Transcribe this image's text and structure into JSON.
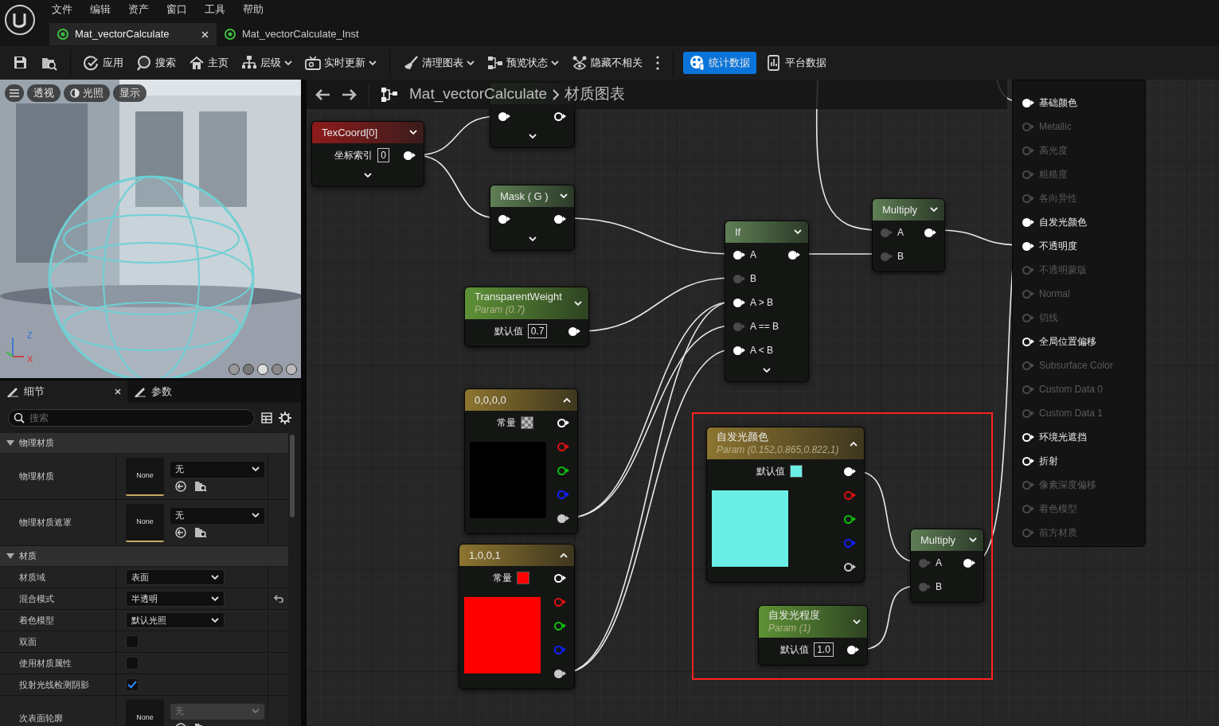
{
  "menu": [
    "文件",
    "编辑",
    "资产",
    "窗口",
    "工具",
    "帮助"
  ],
  "tabs": [
    {
      "label": "Mat_vectorCalculate",
      "selected": true,
      "closable": true
    },
    {
      "label": "Mat_vectorCalculate_Inst",
      "selected": false,
      "closable": false
    }
  ],
  "toolbar": [
    [
      {
        "selected": false,
        "dropdown": false
      },
      {
        "selected": false,
        "dropdown": false
      }
    ],
    [
      {
        "label": "应用",
        "selected": false,
        "dropdown": false
      },
      {
        "label": "搜索",
        "selected": false,
        "dropdown": false
      },
      {
        "label": "主页",
        "selected": false,
        "dropdown": false
      },
      {
        "label": "层级",
        "selected": false,
        "dropdown": true
      },
      {
        "label": "实时更新",
        "selected": false,
        "dropdown": true
      }
    ],
    [
      {
        "label": "清理图表",
        "selected": false,
        "dropdown": true
      },
      {
        "label": "预览状态",
        "selected": false,
        "dropdown": true
      },
      {
        "label": "隐藏不相关",
        "selected": false,
        "dropdown": false
      },
      {
        "selected": false,
        "dropdown": false
      }
    ],
    [
      {
        "label": "统计数据",
        "selected": true,
        "dropdown": false
      },
      {
        "label": "平台数据",
        "selected": false,
        "dropdown": false
      }
    ]
  ],
  "viewport": {
    "buttons": [
      {
        "label": "透视"
      },
      {
        "label": "光照"
      },
      {
        "label": "显示"
      }
    ],
    "axes": [
      "Z",
      "X"
    ]
  },
  "details": {
    "tabs": [
      {
        "label": "细节",
        "selected": true,
        "closable": true
      },
      {
        "label": "参数",
        "selected": false,
        "closable": false
      }
    ],
    "search": {
      "placeholder": "搜索"
    },
    "sections": [
      {
        "title": "物理材质",
        "expanded": true,
        "rows": [
          {
            "kind": "asset",
            "label": "物理材质",
            "thumb": "None",
            "value": "无",
            "disabled": false
          },
          {
            "kind": "asset",
            "label": "物理材质遮罩",
            "thumb": "None",
            "value": "无",
            "disabled": false
          }
        ]
      },
      {
        "title": "材质",
        "expanded": true,
        "rows": [
          {
            "kind": "dropdown",
            "label": "材质域",
            "value": "表面",
            "resettable": false
          },
          {
            "kind": "dropdown",
            "label": "混合模式",
            "value": "半透明",
            "resettable": true
          },
          {
            "kind": "dropdown",
            "label": "着色模型",
            "value": "默认光照",
            "resettable": false
          },
          {
            "kind": "checkbox",
            "label": "双面",
            "checked": false
          },
          {
            "kind": "checkbox",
            "label": "使用材质属性",
            "checked": false
          },
          {
            "kind": "checkbox",
            "label": "投射光线检测阴影",
            "checked": true
          },
          {
            "kind": "asset",
            "label": "次表面轮廓",
            "thumb": "None",
            "value": "无",
            "disabled": true
          }
        ]
      }
    ]
  },
  "graph": {
    "breadcrumb": [
      "Mat_vectorCalculate",
      "材质图表"
    ],
    "nodes": [
      {
        "kind": "function",
        "more_pins": true,
        "rows": [
          {
            "in_connected": true,
            "out_connected": false
          }
        ]
      },
      {
        "kind": "coordinate",
        "title": "TexCoord[0]",
        "expanded": false,
        "more_pins": true,
        "rows": [
          {
            "label": "坐标索引",
            "value": "0",
            "out_connected": true
          }
        ]
      },
      {
        "kind": "function",
        "title": "Mask ( G )",
        "expanded": false,
        "more_pins": true,
        "rows": [
          {
            "in_connected": true,
            "out_connected": true
          }
        ]
      },
      {
        "kind": "parameter",
        "title": "TransparentWeight",
        "subtitle": "Param (0.7)",
        "expanded": false,
        "more_pins": false,
        "rows": [
          {
            "label": "默认值",
            "value": "0.7",
            "out_connected": true
          }
        ]
      },
      {
        "kind": "function",
        "title": "If",
        "expanded": false,
        "more_pins": true,
        "rows": [
          {
            "label": "A",
            "in_connected": true,
            "out_connected": true
          },
          {
            "label": "B",
            "in_connected": false
          },
          {
            "label": "A > B",
            "in_connected": true
          },
          {
            "label": "A == B",
            "in_connected": false
          },
          {
            "label": "A < B",
            "in_connected": true
          }
        ]
      },
      {
        "kind": "function",
        "title": "Multiply",
        "expanded": false,
        "more_pins": false,
        "rows": [
          {
            "label": "A",
            "in_connected": false,
            "out_connected": true
          },
          {
            "label": "B",
            "in_connected": false
          }
        ]
      },
      {
        "kind": "constant",
        "title": "0,0,0,0",
        "expanded": true,
        "more_pins": false,
        "preview": {
          "color": "#000000"
        },
        "rows": [
          {
            "label": "常量",
            "swatch": {
              "kind": "checker"
            },
            "out_connected": false
          },
          {
            "color": "#e01010",
            "out_connected": false
          },
          {
            "color": "#10c010",
            "out_connected": false
          },
          {
            "color": "#1020ff",
            "out_connected": false
          },
          {
            "color": "#c8c8c8",
            "out_connected": true
          }
        ]
      },
      {
        "kind": "constant",
        "title": "1,0,0,1",
        "expanded": true,
        "more_pins": false,
        "preview": {
          "color": "#ff0000"
        },
        "rows": [
          {
            "label": "常量",
            "swatch": {
              "kind": "solid",
              "color": "#ff0000"
            },
            "out_connected": false
          },
          {
            "color": "#e01010",
            "out_connected": false
          },
          {
            "color": "#10c010",
            "out_connected": false
          },
          {
            "color": "#1020ff",
            "out_connected": false
          },
          {
            "color": "#c8c8c8",
            "out_connected": true
          }
        ]
      },
      {
        "kind": "constant",
        "title": "自发光颜色",
        "subtitle": "Param (0.152,0.865,0.822,1)",
        "expanded": true,
        "more_pins": false,
        "preview": {
          "color": "#6aeee6"
        },
        "rows": [
          {
            "label": "默认值",
            "swatch": {
              "kind": "solid",
              "color": "#6aeee6"
            },
            "out_connected": true
          },
          {
            "color": "#e01010",
            "out_connected": false
          },
          {
            "color": "#10c010",
            "out_connected": false
          },
          {
            "color": "#1020ff",
            "out_connected": false
          },
          {
            "color": "#c8c8c8",
            "out_connected": false
          }
        ]
      },
      {
        "kind": "parameter",
        "title": "自发光程度",
        "subtitle": "Param (1)",
        "expanded": false,
        "more_pins": false,
        "rows": [
          {
            "label": "默认值",
            "value": "1.0",
            "out_connected": true
          }
        ]
      },
      {
        "kind": "function",
        "title": "Multiply",
        "expanded": false,
        "more_pins": false,
        "rows": [
          {
            "label": "A",
            "in_connected": false,
            "out_connected": true
          },
          {
            "label": "B",
            "in_connected": false
          }
        ]
      }
    ],
    "result": {
      "pins": [
        {
          "label": "基础颜色",
          "connected": true,
          "enabled": true
        },
        {
          "label": "Metallic",
          "connected": false,
          "enabled": false
        },
        {
          "label": "高光度",
          "connected": false,
          "enabled": false
        },
        {
          "label": "粗糙度",
          "connected": false,
          "enabled": false
        },
        {
          "label": "各向异性",
          "connected": false,
          "enabled": false
        },
        {
          "label": "自发光颜色",
          "connected": true,
          "enabled": true
        },
        {
          "label": "不透明度",
          "connected": true,
          "enabled": true
        },
        {
          "label": "不透明蒙版",
          "connected": false,
          "enabled": false
        },
        {
          "label": "Normal",
          "connected": false,
          "enabled": false
        },
        {
          "label": "切线",
          "connected": false,
          "enabled": false
        },
        {
          "label": "全局位置偏移",
          "connected": false,
          "enabled": true
        },
        {
          "label": "Subsurface Color",
          "connected": false,
          "enabled": false
        },
        {
          "label": "Custom Data 0",
          "connected": false,
          "enabled": false
        },
        {
          "label": "Custom Data 1",
          "connected": false,
          "enabled": false
        },
        {
          "label": "环境光遮挡",
          "connected": false,
          "enabled": true
        },
        {
          "label": "折射",
          "connected": false,
          "enabled": true
        },
        {
          "label": "像素深度偏移",
          "connected": false,
          "enabled": false
        },
        {
          "label": "着色模型",
          "connected": false,
          "enabled": false
        },
        {
          "label": "前方材质",
          "connected": false,
          "enabled": false
        }
      ]
    }
  }
}
